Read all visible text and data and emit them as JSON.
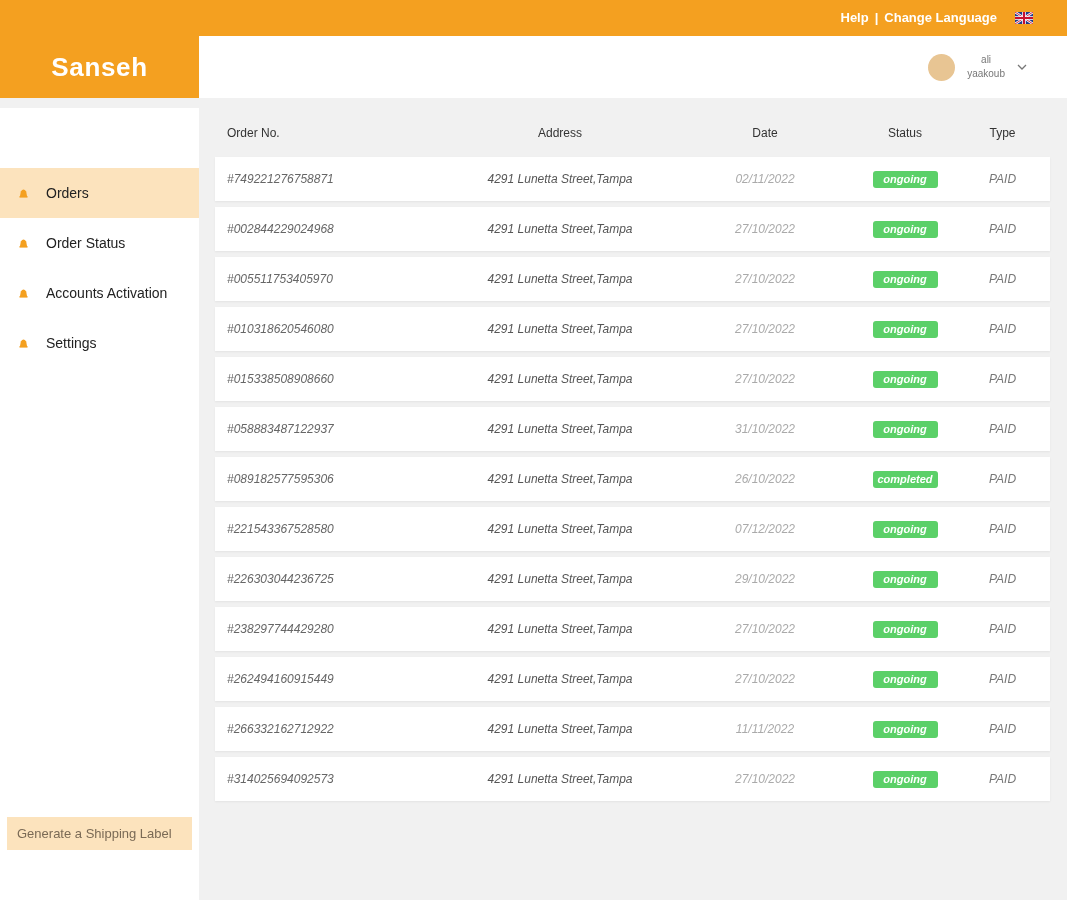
{
  "top_bar": {
    "links": [
      "Help",
      "Change Language"
    ],
    "separator": "|"
  },
  "logo": "Sanseh",
  "user": {
    "first_name": "ali",
    "last_name": "yaakoub"
  },
  "sidebar": {
    "items": [
      {
        "label": "Orders",
        "selected": true
      },
      {
        "label": "Order Status",
        "selected": false
      },
      {
        "label": "Accounts Activation",
        "selected": false
      },
      {
        "label": "Settings",
        "selected": false
      }
    ],
    "action": "Generate a Shipping Label"
  },
  "table": {
    "columns": [
      "Order No.",
      "Address",
      "Date",
      "Status",
      "Type"
    ],
    "rows": [
      [
        "#749221276758871",
        "4291 Lunetta Street,Tampa",
        "02/11/2022",
        "ongoing",
        "PAID"
      ],
      [
        "#002844229024968",
        "4291 Lunetta Street,Tampa",
        "27/10/2022",
        "ongoing",
        "PAID"
      ],
      [
        "#005511753405970",
        "4291 Lunetta Street,Tampa",
        "27/10/2022",
        "ongoing",
        "PAID"
      ],
      [
        "#010318620546080",
        "4291 Lunetta Street,Tampa",
        "27/10/2022",
        "ongoing",
        "PAID"
      ],
      [
        "#015338508908660",
        "4291 Lunetta Street,Tampa",
        "27/10/2022",
        "ongoing",
        "PAID"
      ],
      [
        "#058883487122937",
        "4291 Lunetta Street,Tampa",
        "31/10/2022",
        "ongoing",
        "PAID"
      ],
      [
        "#089182577595306",
        "4291 Lunetta Street,Tampa",
        "26/10/2022",
        "completed",
        "PAID"
      ],
      [
        "#221543367528580",
        "4291 Lunetta Street,Tampa",
        "07/12/2022",
        "ongoing",
        "PAID"
      ],
      [
        "#226303044236725",
        "4291 Lunetta Street,Tampa",
        "29/10/2022",
        "ongoing",
        "PAID"
      ],
      [
        "#238297744429280",
        "4291 Lunetta Street,Tampa",
        "27/10/2022",
        "ongoing",
        "PAID"
      ],
      [
        "#262494160915449",
        "4291 Lunetta Street,Tampa",
        "27/10/2022",
        "ongoing",
        "PAID"
      ],
      [
        "#266332162712922",
        "4291 Lunetta Street,Tampa",
        "11/11/2022",
        "ongoing",
        "PAID"
      ],
      [
        "#314025694092573",
        "4291 Lunetta Street,Tampa",
        "27/10/2022",
        "ongoing",
        "PAID"
      ]
    ]
  }
}
